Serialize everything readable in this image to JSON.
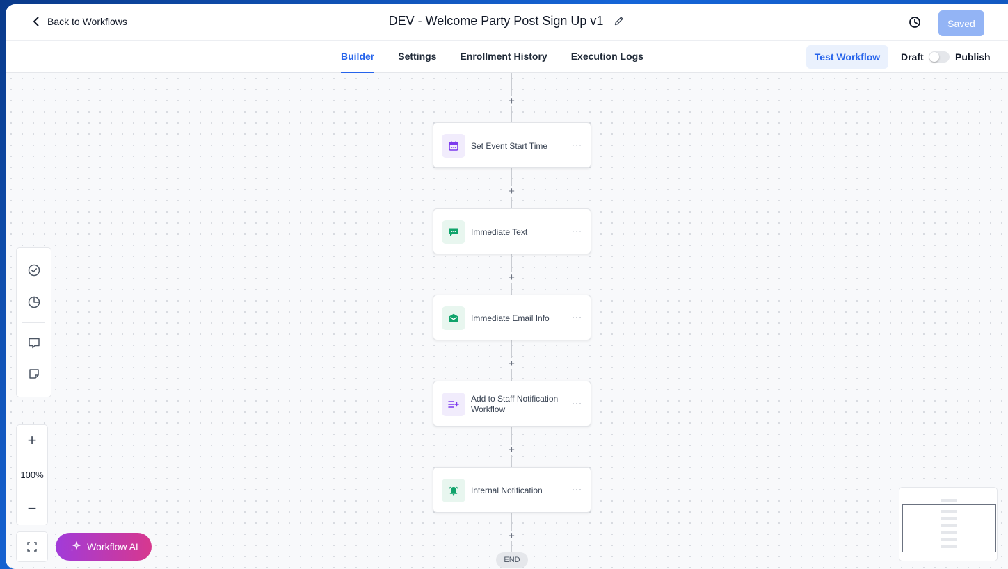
{
  "header": {
    "back_label": "Back to Workflows",
    "title": "DEV - Welcome Party Post Sign Up v1",
    "saved_label": "Saved"
  },
  "tabs": [
    {
      "label": "Builder",
      "active": true
    },
    {
      "label": "Settings",
      "active": false
    },
    {
      "label": "Enrollment History",
      "active": false
    },
    {
      "label": "Execution Logs",
      "active": false
    }
  ],
  "actions": {
    "test_workflow_label": "Test Workflow",
    "draft_label": "Draft",
    "publish_label": "Publish",
    "published": false
  },
  "nodes": [
    {
      "label": "Set Event Start Time",
      "icon": "calendar-icon",
      "color": "#7c3aed"
    },
    {
      "label": "Immediate Text",
      "icon": "chat-icon",
      "color": "#10a36b"
    },
    {
      "label": "Immediate Email Info",
      "icon": "email-icon",
      "color": "#10a36b"
    },
    {
      "label": "Add to Staff Notification Workflow",
      "icon": "list-add-icon",
      "color": "#7c3aed"
    },
    {
      "label": "Internal Notification",
      "icon": "bell-icon",
      "color": "#10a36b"
    }
  ],
  "end_label": "END",
  "zoom": {
    "level": "100%"
  },
  "ai_button_label": "Workflow AI",
  "colors": {
    "accent": "#2563eb",
    "saved_button": "#93b4f5"
  }
}
